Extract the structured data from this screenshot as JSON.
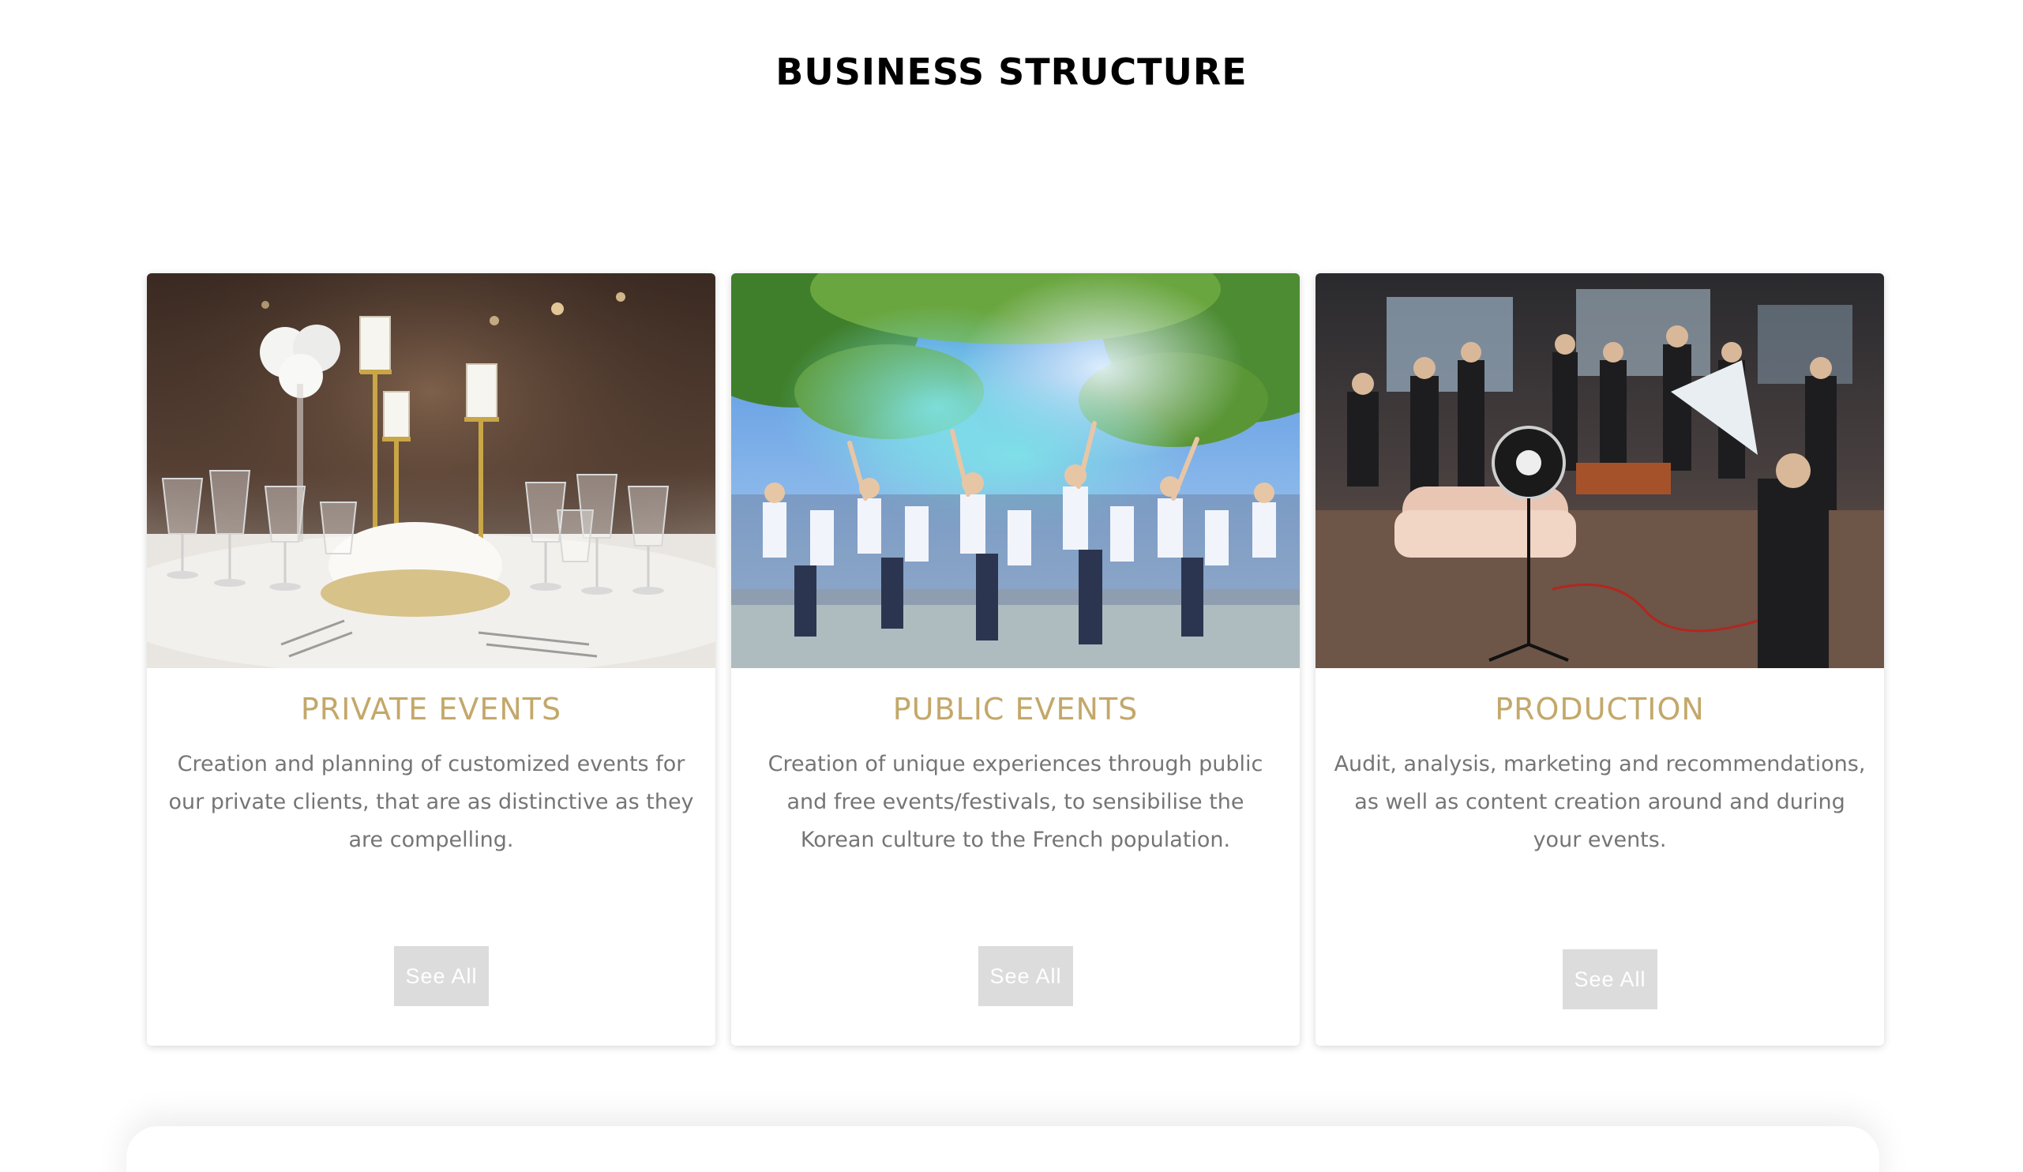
{
  "section": {
    "title": "BUSINESS STRUCTURE"
  },
  "cards": [
    {
      "title": "PRIVATE EVENTS",
      "description": "Creation and planning of customized events for our private clients, that are as distinctive as they are compelling.",
      "button_label": "See All",
      "image_subject": "banquet table with candles and glasses"
    },
    {
      "title": "PUBLIC EVENTS",
      "description": "Creation of unique experiences through public and free events/festivals, to sensibilise the Korean culture to the French population.",
      "button_label": "See All",
      "image_subject": "color festival crowd"
    },
    {
      "title": "PRODUCTION",
      "description": "Audit, analysis, marketing and recommendations, as well as content creation around and during your events.",
      "button_label": "See All",
      "image_subject": "studio production with lighting"
    }
  ],
  "colors": {
    "card_title": "#c3a86a",
    "description": "#757575",
    "button_bg": "#dcdcdc",
    "button_text": "#ffffff"
  }
}
